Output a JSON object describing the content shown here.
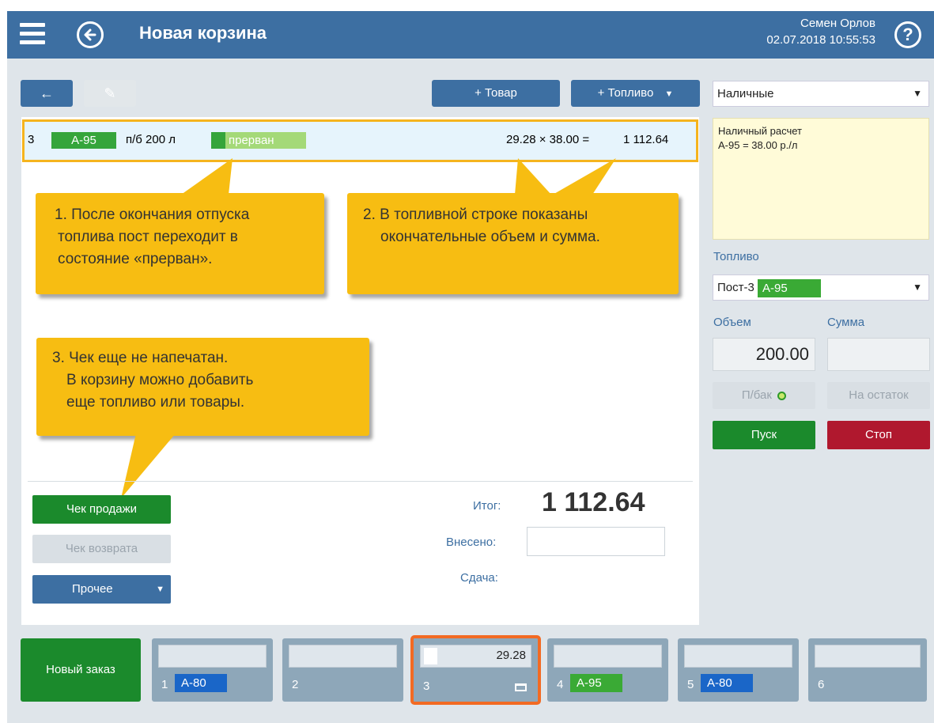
{
  "header": {
    "title": "Новая корзина",
    "user_name": "Семен Орлов",
    "datetime": "02.07.2018 10:55:53",
    "help_symbol": "?"
  },
  "toolbar": {
    "back_symbol": "←",
    "edit_symbol": "✎",
    "add_product_label": "+ Товар",
    "add_fuel_label": "+ Топливо",
    "add_fuel_arrow": "▼"
  },
  "fuel_row": {
    "post_number": "3",
    "fuel_type": "А-95",
    "mode": "п/б 200 л",
    "status": "прерван",
    "calc": "29.28 × 38.00 =",
    "sum": "1 112.64"
  },
  "callouts": {
    "c1_line1": "1. После окончания отпуска",
    "c1_line2": "топлива пост переходит в",
    "c1_line3": "состояние «прерван».",
    "c2_line1": "2. В топливной строке показаны",
    "c2_line2": "окончательные объем и сумма.",
    "c3_line1": "3. Чек еще не напечатан.",
    "c3_line2": "В корзину можно добавить",
    "c3_line3": "еще топливо или товары."
  },
  "actions": {
    "sale_receipt": "Чек продажи",
    "return_receipt": "Чек возврата",
    "other": "Прочее",
    "other_arrow": "▼"
  },
  "totals": {
    "total_label": "Итог:",
    "total_value": "1 112.64",
    "paid_label": "Внесено:",
    "paid_value": "",
    "change_label": "Сдача:"
  },
  "right_panel": {
    "payment_type": "Наличные",
    "payment_arrow": "▼",
    "note_line1": "Наличный расчет",
    "note_line2": "А-95 = 38.00 р./л",
    "fuel_label": "Топливо",
    "post_select_prefix": "Пост-3",
    "post_select_fuel": "А-95",
    "post_select_arrow": "▼",
    "volume_label": "Объем",
    "sum_label": "Сумма",
    "volume_value": "200.00",
    "sum_value": "",
    "full_tank_label": "П/бак",
    "remainder_label": "На остаток",
    "start_label": "Пуск",
    "stop_label": "Стоп"
  },
  "orders": {
    "new_order_label": "Новый заказ",
    "tiles": [
      {
        "num": "1",
        "fuel": "А-80",
        "value": ""
      },
      {
        "num": "2",
        "fuel": "",
        "value": ""
      },
      {
        "num": "3",
        "fuel": "",
        "value": "29.28"
      },
      {
        "num": "4",
        "fuel": "А-95",
        "value": ""
      },
      {
        "num": "5",
        "fuel": "А-80",
        "value": ""
      },
      {
        "num": "6",
        "fuel": "",
        "value": ""
      }
    ]
  },
  "colors": {
    "header_blue": "#3d6fa2",
    "callout_yellow": "#f7bd12",
    "active_orange": "#f26a23",
    "start_green": "#1b8a2c",
    "stop_red": "#b0182e"
  }
}
